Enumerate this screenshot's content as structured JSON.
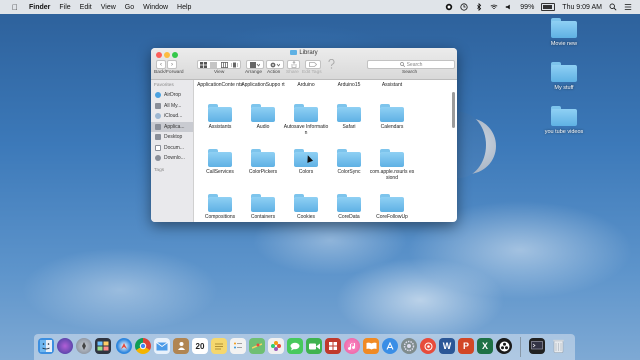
{
  "menubar": {
    "apple": "",
    "app": "Finder",
    "items": [
      "File",
      "Edit",
      "View",
      "Go",
      "Window",
      "Help"
    ],
    "battery": "99%",
    "clock": "Thu 9:09 AM"
  },
  "desktop": {
    "items": [
      {
        "label": "Movie new"
      },
      {
        "label": "My stuff"
      },
      {
        "label": "you tube videos"
      }
    ]
  },
  "window": {
    "title": "Library",
    "back_glyph": "‹",
    "forward_glyph": "›",
    "labels": {
      "back_forward": "Back/Forward",
      "view": "View",
      "arrange": "Arrange",
      "action": "Action",
      "share": "Share",
      "edit_tags": "Edit Tags",
      "search": "Search"
    },
    "search_placeholder": "Search",
    "sidebar": {
      "favorites_header": "Favorites",
      "tags_header": "Tags",
      "items": [
        {
          "label": "AirDrop",
          "icon": "airdrop-icon"
        },
        {
          "label": "All My...",
          "icon": "all-files-icon"
        },
        {
          "label": "iCloud...",
          "icon": "icloud-icon"
        },
        {
          "label": "Applica...",
          "icon": "applications-icon"
        },
        {
          "label": "Desktop",
          "icon": "desktop-icon"
        },
        {
          "label": "Docum...",
          "icon": "documents-icon"
        },
        {
          "label": "Downlo...",
          "icon": "downloads-icon"
        }
      ]
    },
    "top_row": [
      "ApplicationConte nts",
      "ApplicationSuppo rt",
      "Arduino",
      "Arduino15",
      "Assistant"
    ],
    "folders": [
      "Assistants",
      "Audio",
      "Autosave Information",
      "Safari",
      "Calendars",
      "CallServices",
      "ColorPickers",
      "Colors",
      "ColorSync",
      "com.apple.nsurls essiond",
      "Compositions",
      "Containers",
      "Cookies",
      "CoreData",
      "CoreFollowUp"
    ]
  },
  "dock": {
    "icons": [
      {
        "name": "finder",
        "color": "#3d8fe0"
      },
      {
        "name": "siri",
        "color": "#6b4fc9"
      },
      {
        "name": "launchpad",
        "color": "#8a8f99"
      },
      {
        "name": "mission-control",
        "color": "#2f3440"
      },
      {
        "name": "safari",
        "color": "#2e86de"
      },
      {
        "name": "chrome",
        "color": "#e24e3b"
      },
      {
        "name": "mail",
        "color": "#4b9be8"
      },
      {
        "name": "contacts",
        "color": "#b08552"
      },
      {
        "name": "calendar",
        "color": "#ffffff"
      },
      {
        "name": "notes",
        "color": "#f5d76e"
      },
      {
        "name": "reminders",
        "color": "#f2f2f2"
      },
      {
        "name": "maps",
        "color": "#6fbf73"
      },
      {
        "name": "photos",
        "color": "#f0f0f0"
      },
      {
        "name": "messages",
        "color": "#47c95d"
      },
      {
        "name": "facetime",
        "color": "#3fb34f"
      },
      {
        "name": "photo-booth",
        "color": "#c0392b"
      },
      {
        "name": "itunes",
        "color": "#e65ea0"
      },
      {
        "name": "ibooks",
        "color": "#f08a24"
      },
      {
        "name": "app-store",
        "color": "#3a8ee6"
      },
      {
        "name": "system-preferences",
        "color": "#7f8c8d"
      },
      {
        "name": "itunes-connect",
        "color": "#e74c3c"
      },
      {
        "name": "word",
        "color": "#2b5797"
      },
      {
        "name": "powerpoint",
        "color": "#d24726"
      },
      {
        "name": "excel",
        "color": "#1e7145"
      },
      {
        "name": "obs",
        "color": "#1a1a1a"
      },
      {
        "name": "terminal",
        "color": "#222222"
      },
      {
        "name": "trash",
        "color": "#cfd4da"
      }
    ],
    "calendar_day": "20",
    "word_letter": "W",
    "powerpoint_letter": "P",
    "excel_letter": "X"
  }
}
